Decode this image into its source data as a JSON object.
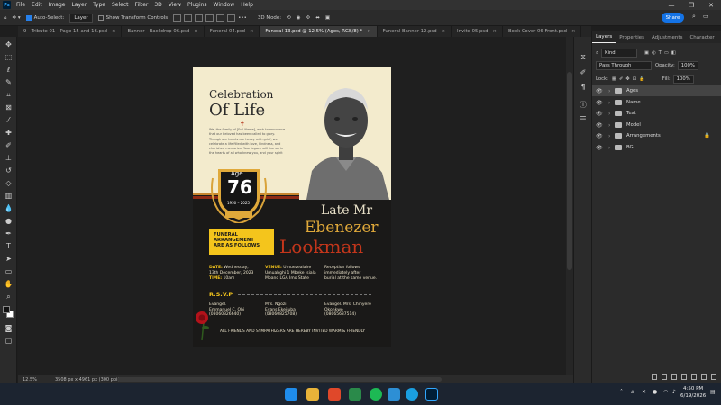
{
  "app": {
    "logo": "Ps",
    "menu": [
      "File",
      "Edit",
      "Image",
      "Layer",
      "Type",
      "Select",
      "Filter",
      "3D",
      "View",
      "Plugins",
      "Window",
      "Help"
    ],
    "window_controls": [
      "—",
      "❐",
      "✕"
    ]
  },
  "options": {
    "auto_select_label": "Auto-Select:",
    "auto_select_value": "Layer",
    "transform_label": "Show Transform Controls",
    "mode_3d": "3D Mode:",
    "share": "Share"
  },
  "tabs": [
    {
      "label": "9 - Tribute 01 - Page 15 and 16.psd"
    },
    {
      "label": "Banner - Backdrop 06.psd"
    },
    {
      "label": "Funeral 04.psd"
    },
    {
      "label": "Funeral 13.psd @ 12.5% (Ages, RGB/8) *"
    },
    {
      "label": "Funeral Banner 12.psd"
    },
    {
      "label": "Invite 05.psd"
    },
    {
      "label": "Book Cover 06 Front.psd"
    }
  ],
  "status": {
    "zoom": "12.5%",
    "doc_size": "3508 px x 4961 px (300 ppi)"
  },
  "layers_panel": {
    "tabs": [
      "Layers",
      "Properties",
      "Adjustments",
      "Character"
    ],
    "filter_kind": "Kind",
    "blend_mode": "Pass Through",
    "opacity_label": "Opacity:",
    "opacity": "100%",
    "lock_label": "Lock:",
    "fill_label": "Fill:",
    "fill": "100%",
    "layers": [
      {
        "name": "Ages",
        "selected": true
      },
      {
        "name": "Name"
      },
      {
        "name": "Text"
      },
      {
        "name": "Model"
      },
      {
        "name": "Arrangements",
        "locked": true
      },
      {
        "name": "BG"
      }
    ]
  },
  "poster": {
    "title_small": "Celebration",
    "title_big": "Of Life",
    "intro": [
      "We, the family of [Full Name], wish to announce",
      "that our beloved has been called to glory.",
      "Though our hearts are heavy with grief, we",
      "celebrate a life filled with love, kindness, and",
      "cherished memories. Your legacy will live on in",
      "the hearts of all who knew you, and your spirit"
    ],
    "age_label": "Age",
    "age": "76",
    "years": "1950 – 2025",
    "name_prefix": "Late Mr",
    "first_name": "Ebenezer",
    "last_name": "Lookman",
    "arrangement": [
      "FUNERAL",
      "ARRANGEMENT",
      "ARE AS FOLLOWS"
    ],
    "date_label": "DATE:",
    "date_value": "Wednesday,",
    "date_value2": "13th December, 2023",
    "time_label": "TIME:",
    "time_value": "10am",
    "venue_label": "VENUE:",
    "venue_value": "Umuezealaire",
    "venue_value2": "Umuabghi 1 Mbeke Isiala",
    "venue_value3": "Mbano LGA Imo State",
    "reception": [
      "Reception follows",
      "immediately after",
      "burial at the same venue."
    ],
    "rsvp": "R.S.V.P",
    "contacts": [
      {
        "l1": "Evangel.",
        "l2": "Emmanuel C. Obi",
        "l3": "(08060326640)"
      },
      {
        "l1": "Mrs. Ngozi",
        "l2": "Evans Ekejiuba",
        "l3": "(08060825708)"
      },
      {
        "l1": "Evangel. Mrs. Chinyere",
        "l2": "Okonkwo",
        "l3": "(08065687514)"
      }
    ],
    "footer": "ALL FRIENDS AND SYMPATHIZERS ARE HEREBY INVITED WARM & FRIENDLY"
  },
  "taskbar": {
    "time": "4:50 PM",
    "date": "6/19/2026"
  },
  "colors": {
    "poster_cream": "#f3ebcd",
    "poster_dark": "#1a1918",
    "accent_red": "#b5341a",
    "accent_gold": "#e0a93a",
    "yellow_box": "#f4c51c",
    "ps_blue": "#31a8ff"
  }
}
